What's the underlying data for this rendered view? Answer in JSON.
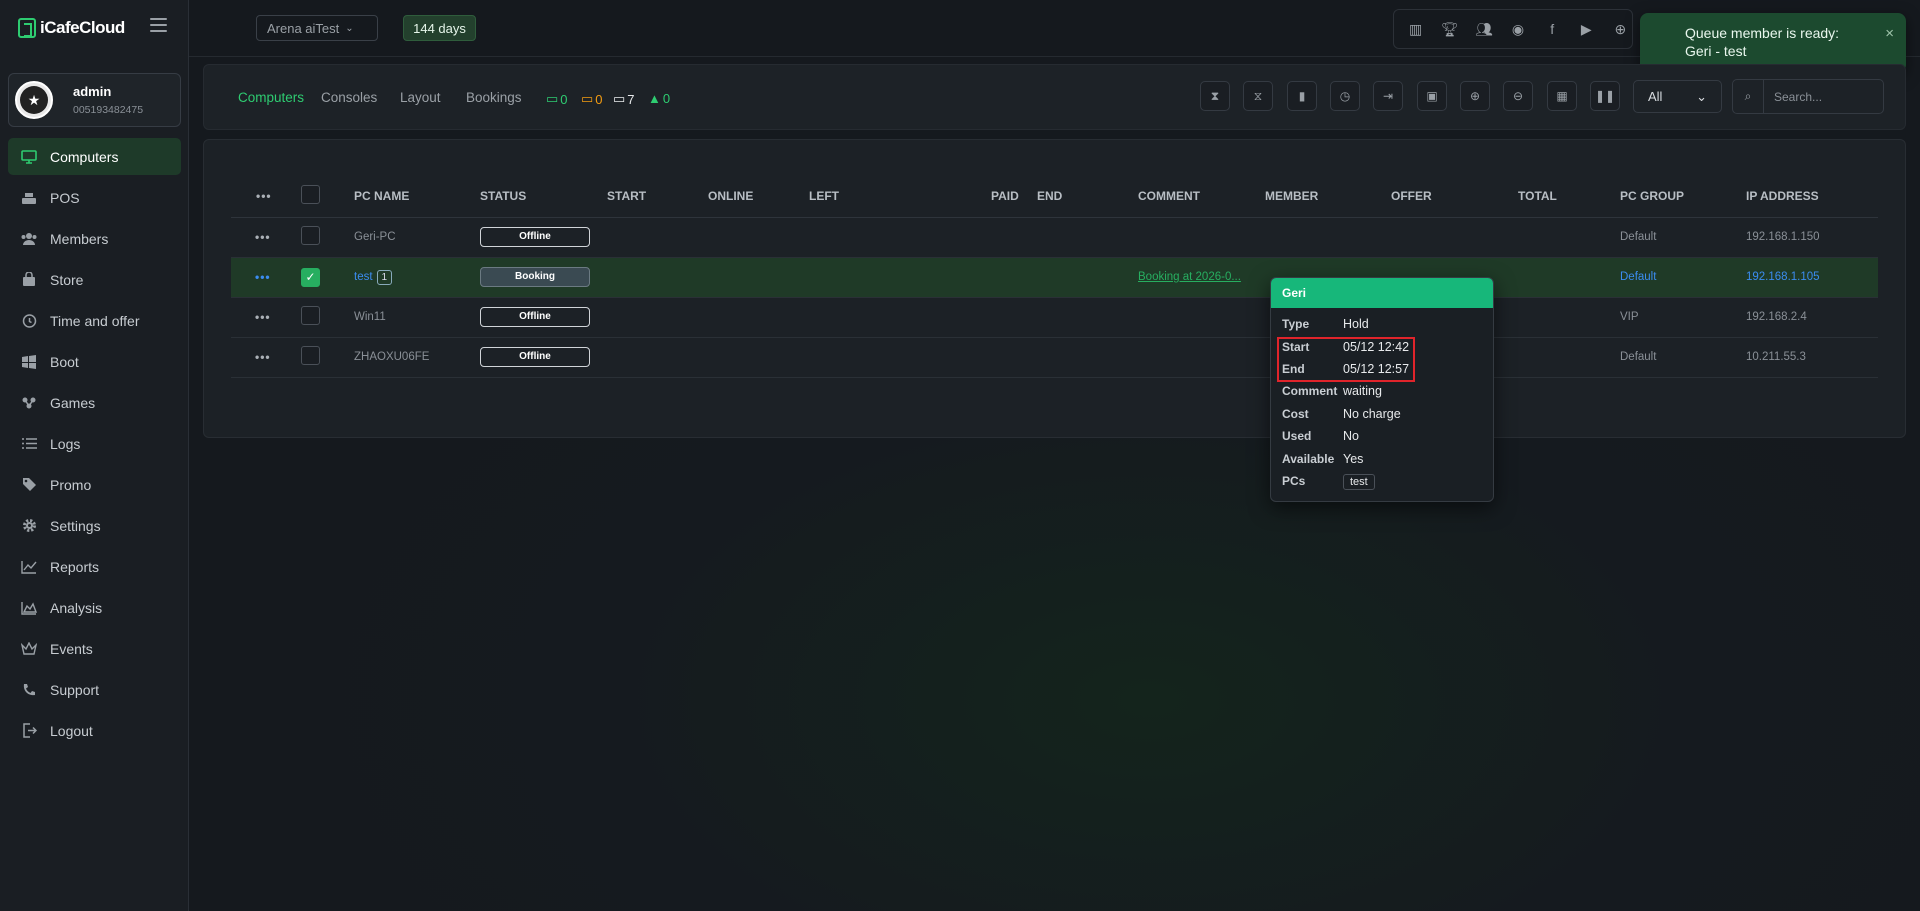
{
  "brand": {
    "name": "iCafeCloud"
  },
  "user": {
    "name": "admin",
    "id": "005193482475"
  },
  "sidebar": {
    "items": [
      {
        "label": "Computers",
        "icon": "monitor-icon"
      },
      {
        "label": "POS",
        "icon": "register-icon"
      },
      {
        "label": "Members",
        "icon": "users-icon"
      },
      {
        "label": "Store",
        "icon": "bag-icon"
      },
      {
        "label": "Time and offer",
        "icon": "clock-icon"
      },
      {
        "label": "Boot",
        "icon": "windows-icon"
      },
      {
        "label": "Games",
        "icon": "gamepad-icon"
      },
      {
        "label": "Logs",
        "icon": "list-icon"
      },
      {
        "label": "Promo",
        "icon": "tag-icon"
      },
      {
        "label": "Settings",
        "icon": "gear-icon"
      },
      {
        "label": "Reports",
        "icon": "chart-line-icon"
      },
      {
        "label": "Analysis",
        "icon": "chart-area-icon"
      },
      {
        "label": "Events",
        "icon": "crown-icon"
      },
      {
        "label": "Support",
        "icon": "phone-icon"
      },
      {
        "label": "Logout",
        "icon": "logout-icon"
      }
    ]
  },
  "header": {
    "store": "Arena aiTest",
    "days": "144 days"
  },
  "toast": {
    "message": "Queue member is ready: Geri - test",
    "close": "×"
  },
  "tabs": [
    {
      "label": "Computers"
    },
    {
      "label": "Consoles"
    },
    {
      "label": "Layout"
    },
    {
      "label": "Bookings"
    }
  ],
  "stats": {
    "green": "0",
    "orange": "0",
    "white": "7",
    "members": "0"
  },
  "filter": {
    "value": "All"
  },
  "search": {
    "placeholder": "Search..."
  },
  "table": {
    "headers": [
      "PC NAME",
      "STATUS",
      "START",
      "ONLINE",
      "LEFT",
      "PAID",
      "END",
      "COMMENT",
      "MEMBER",
      "OFFER",
      "TOTAL",
      "PC GROUP",
      "IP ADDRESS"
    ],
    "rows": [
      {
        "name": "Geri-PC",
        "status": "Offline",
        "comment": "",
        "group": "Default",
        "ip": "192.168.1.150"
      },
      {
        "name": "test",
        "badge": "1",
        "status": "Booking",
        "comment": "Booking at 2026-0...",
        "group": "Default",
        "ip": "192.168.1.105"
      },
      {
        "name": "Win11",
        "status": "Offline",
        "comment": "",
        "group": "VIP",
        "ip": "192.168.2.4"
      },
      {
        "name": "ZHAOXU06FE",
        "status": "Offline",
        "comment": "",
        "group": "Default",
        "ip": "10.211.55.3"
      }
    ]
  },
  "popover": {
    "title": "Geri",
    "rows": [
      {
        "k": "Type",
        "v": "Hold"
      },
      {
        "k": "Start",
        "v": "05/12 12:42"
      },
      {
        "k": "End",
        "v": "05/12 12:57"
      },
      {
        "k": "Comment",
        "v": "waiting"
      },
      {
        "k": "Cost",
        "v": "No charge"
      },
      {
        "k": "Used",
        "v": "No"
      },
      {
        "k": "Available",
        "v": "Yes"
      },
      {
        "k": "PCs",
        "v": "test"
      }
    ]
  },
  "colors": {
    "accent": "#2ecc71",
    "toast": "#1c4a2f",
    "popover_header": "#17b77a",
    "highlight": "#e0242b",
    "link": "#3b8cf0"
  }
}
